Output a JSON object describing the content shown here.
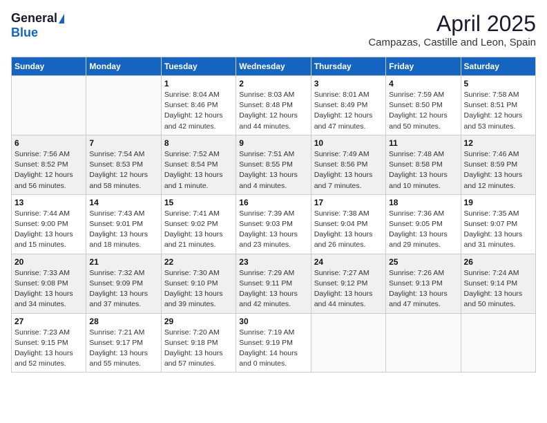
{
  "header": {
    "logo_general": "General",
    "logo_blue": "Blue",
    "month_title": "April 2025",
    "location": "Campazas, Castille and Leon, Spain"
  },
  "days_of_week": [
    "Sunday",
    "Monday",
    "Tuesday",
    "Wednesday",
    "Thursday",
    "Friday",
    "Saturday"
  ],
  "weeks": [
    [
      {
        "day": "",
        "info": ""
      },
      {
        "day": "",
        "info": ""
      },
      {
        "day": "1",
        "info": "Sunrise: 8:04 AM\nSunset: 8:46 PM\nDaylight: 12 hours\nand 42 minutes."
      },
      {
        "day": "2",
        "info": "Sunrise: 8:03 AM\nSunset: 8:48 PM\nDaylight: 12 hours\nand 44 minutes."
      },
      {
        "day": "3",
        "info": "Sunrise: 8:01 AM\nSunset: 8:49 PM\nDaylight: 12 hours\nand 47 minutes."
      },
      {
        "day": "4",
        "info": "Sunrise: 7:59 AM\nSunset: 8:50 PM\nDaylight: 12 hours\nand 50 minutes."
      },
      {
        "day": "5",
        "info": "Sunrise: 7:58 AM\nSunset: 8:51 PM\nDaylight: 12 hours\nand 53 minutes."
      }
    ],
    [
      {
        "day": "6",
        "info": "Sunrise: 7:56 AM\nSunset: 8:52 PM\nDaylight: 12 hours\nand 56 minutes."
      },
      {
        "day": "7",
        "info": "Sunrise: 7:54 AM\nSunset: 8:53 PM\nDaylight: 12 hours\nand 58 minutes."
      },
      {
        "day": "8",
        "info": "Sunrise: 7:52 AM\nSunset: 8:54 PM\nDaylight: 13 hours\nand 1 minute."
      },
      {
        "day": "9",
        "info": "Sunrise: 7:51 AM\nSunset: 8:55 PM\nDaylight: 13 hours\nand 4 minutes."
      },
      {
        "day": "10",
        "info": "Sunrise: 7:49 AM\nSunset: 8:56 PM\nDaylight: 13 hours\nand 7 minutes."
      },
      {
        "day": "11",
        "info": "Sunrise: 7:48 AM\nSunset: 8:58 PM\nDaylight: 13 hours\nand 10 minutes."
      },
      {
        "day": "12",
        "info": "Sunrise: 7:46 AM\nSunset: 8:59 PM\nDaylight: 13 hours\nand 12 minutes."
      }
    ],
    [
      {
        "day": "13",
        "info": "Sunrise: 7:44 AM\nSunset: 9:00 PM\nDaylight: 13 hours\nand 15 minutes."
      },
      {
        "day": "14",
        "info": "Sunrise: 7:43 AM\nSunset: 9:01 PM\nDaylight: 13 hours\nand 18 minutes."
      },
      {
        "day": "15",
        "info": "Sunrise: 7:41 AM\nSunset: 9:02 PM\nDaylight: 13 hours\nand 21 minutes."
      },
      {
        "day": "16",
        "info": "Sunrise: 7:39 AM\nSunset: 9:03 PM\nDaylight: 13 hours\nand 23 minutes."
      },
      {
        "day": "17",
        "info": "Sunrise: 7:38 AM\nSunset: 9:04 PM\nDaylight: 13 hours\nand 26 minutes."
      },
      {
        "day": "18",
        "info": "Sunrise: 7:36 AM\nSunset: 9:05 PM\nDaylight: 13 hours\nand 29 minutes."
      },
      {
        "day": "19",
        "info": "Sunrise: 7:35 AM\nSunset: 9:07 PM\nDaylight: 13 hours\nand 31 minutes."
      }
    ],
    [
      {
        "day": "20",
        "info": "Sunrise: 7:33 AM\nSunset: 9:08 PM\nDaylight: 13 hours\nand 34 minutes."
      },
      {
        "day": "21",
        "info": "Sunrise: 7:32 AM\nSunset: 9:09 PM\nDaylight: 13 hours\nand 37 minutes."
      },
      {
        "day": "22",
        "info": "Sunrise: 7:30 AM\nSunset: 9:10 PM\nDaylight: 13 hours\nand 39 minutes."
      },
      {
        "day": "23",
        "info": "Sunrise: 7:29 AM\nSunset: 9:11 PM\nDaylight: 13 hours\nand 42 minutes."
      },
      {
        "day": "24",
        "info": "Sunrise: 7:27 AM\nSunset: 9:12 PM\nDaylight: 13 hours\nand 44 minutes."
      },
      {
        "day": "25",
        "info": "Sunrise: 7:26 AM\nSunset: 9:13 PM\nDaylight: 13 hours\nand 47 minutes."
      },
      {
        "day": "26",
        "info": "Sunrise: 7:24 AM\nSunset: 9:14 PM\nDaylight: 13 hours\nand 50 minutes."
      }
    ],
    [
      {
        "day": "27",
        "info": "Sunrise: 7:23 AM\nSunset: 9:15 PM\nDaylight: 13 hours\nand 52 minutes."
      },
      {
        "day": "28",
        "info": "Sunrise: 7:21 AM\nSunset: 9:17 PM\nDaylight: 13 hours\nand 55 minutes."
      },
      {
        "day": "29",
        "info": "Sunrise: 7:20 AM\nSunset: 9:18 PM\nDaylight: 13 hours\nand 57 minutes."
      },
      {
        "day": "30",
        "info": "Sunrise: 7:19 AM\nSunset: 9:19 PM\nDaylight: 14 hours\nand 0 minutes."
      },
      {
        "day": "",
        "info": ""
      },
      {
        "day": "",
        "info": ""
      },
      {
        "day": "",
        "info": ""
      }
    ]
  ]
}
